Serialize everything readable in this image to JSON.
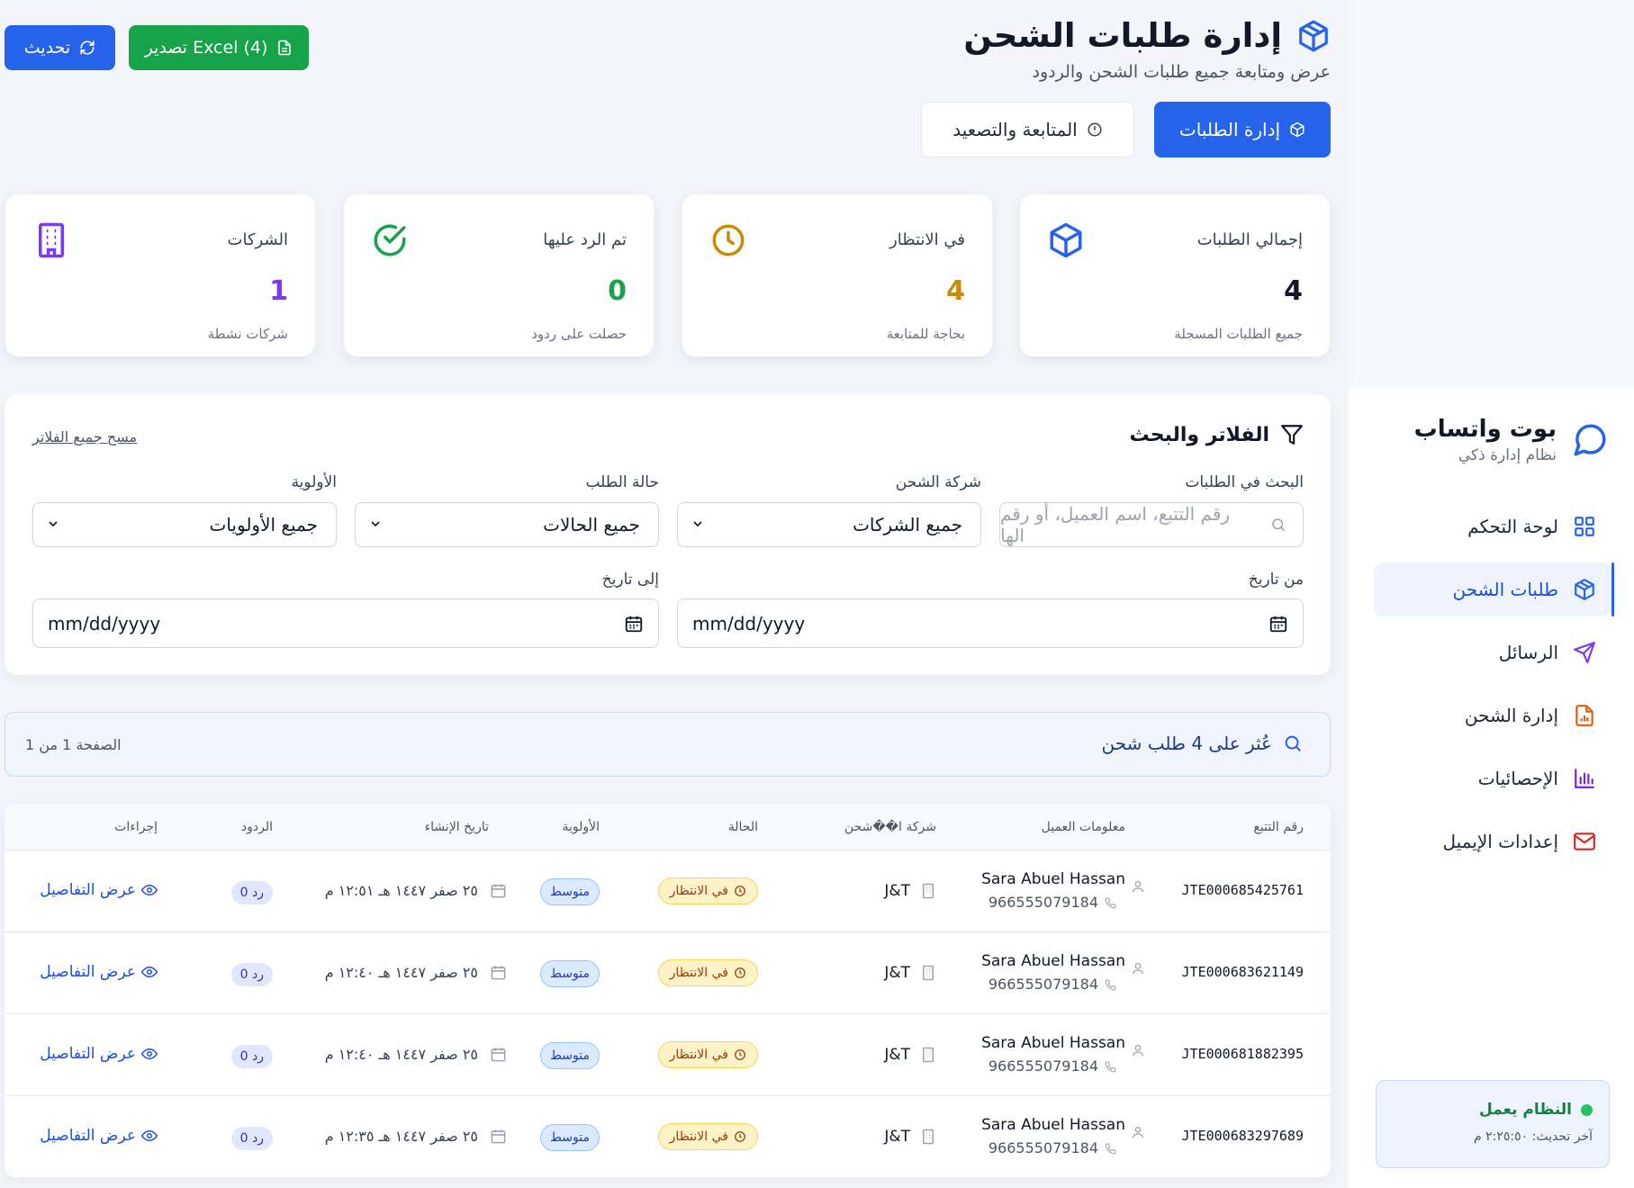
{
  "header": {
    "title": "إدارة طلبات الشحن",
    "subtitle": "عرض ومتابعة جميع طلبات الشحن والردود",
    "refresh_label": "تحديث",
    "export_label": "تصدير Excel (4)",
    "manage_label": "إدارة الطلبات",
    "follow_label": "المتابعة والتصعيد"
  },
  "stats": [
    {
      "label": "إجمالي الطلبات",
      "value": "4",
      "sub": "جميع الطلبات المسجلة",
      "color": "#111827"
    },
    {
      "label": "في الانتظار",
      "value": "4",
      "sub": "بحاجة للمتابعة",
      "color": "#ca8a04"
    },
    {
      "label": "تم الرد عليها",
      "value": "0",
      "sub": "حصلت على ردود",
      "color": "#16a34a"
    },
    {
      "label": "الشركات",
      "value": "1",
      "sub": "شركات نشطة",
      "color": "#7c3aed"
    }
  ],
  "filters": {
    "title": "الفلاتر والبحث",
    "clear_label": "مسح جميع الفلاتر",
    "search_label": "البحث في الطلبات",
    "search_placeholder": "رقم التتبع، اسم العميل، أو رقم الها",
    "company_label": "شركة الشحن",
    "company_value": "جميع الشركات",
    "status_label": "حالة الطلب",
    "status_value": "جميع الحالات",
    "priority_label": "الأولوية",
    "priority_value": "جميع الأولويات",
    "from_label": "من تاريخ",
    "to_label": "إلى تاريخ",
    "date_placeholder": "mm/dd/yyyy"
  },
  "results": {
    "text": "عُثر على 4 طلب شحن",
    "page": "الصفحة 1 من 1"
  },
  "table": {
    "headers": {
      "tracking": "رقم التتبع",
      "customer": "معلومات العميل",
      "company": "شركة ا��شحن",
      "status": "الحالة",
      "priority": "الأولوية",
      "created": "تاريخ الإنشاء",
      "replies": "الردود",
      "actions": "إجراءات"
    },
    "rows": [
      {
        "tracking": "JTE000685425761",
        "name": "Sara Abuel Hassan",
        "phone": "966555079184",
        "company": "J&T",
        "status": "في الانتظار",
        "priority": "متوسط",
        "created": "٢٥ صفر ١٤٤٧ هـ ١٢:٥١ م",
        "replies": "0 رد",
        "action": "عرض التفاصيل"
      },
      {
        "tracking": "JTE000683621149",
        "name": "Sara Abuel Hassan",
        "phone": "966555079184",
        "company": "J&T",
        "status": "في الانتظار",
        "priority": "متوسط",
        "created": "٢٥ صفر ١٤٤٧ هـ ١٢:٤٠ م",
        "replies": "0 رد",
        "action": "عرض التفاصيل"
      },
      {
        "tracking": "JTE000681882395",
        "name": "Sara Abuel Hassan",
        "phone": "966555079184",
        "company": "J&T",
        "status": "في الانتظار",
        "priority": "متوسط",
        "created": "٢٥ صفر ١٤٤٧ هـ ١٢:٤٠ م",
        "replies": "0 رد",
        "action": "عرض التفاصيل"
      },
      {
        "tracking": "JTE000683297689",
        "name": "Sara Abuel Hassan",
        "phone": "966555079184",
        "company": "J&T",
        "status": "في الانتظار",
        "priority": "متوسط",
        "created": "٢٥ صفر ١٤٤٧ هـ ١٢:٣٥ م",
        "replies": "0 رد",
        "action": "عرض التفاصيل"
      }
    ]
  },
  "sidebar": {
    "brand_title": "بوت واتساب",
    "brand_sub": "نظام إدارة ذكي",
    "items": [
      {
        "label": "لوحة التحكم",
        "icon": "grid-icon",
        "color": "#2563eb"
      },
      {
        "label": "طلبات الشحن",
        "icon": "package-icon",
        "color": "#2563eb"
      },
      {
        "label": "الرسائل",
        "icon": "send-icon",
        "color": "#7c3aed"
      },
      {
        "label": "إدارة الشحن",
        "icon": "file-chart-icon",
        "color": "#ea580c"
      },
      {
        "label": "الإحصائيات",
        "icon": "bar-chart-icon",
        "color": "#6d28d9"
      },
      {
        "label": "إعدادات الإيميل",
        "icon": "mail-icon",
        "color": "#dc2626"
      }
    ],
    "status_text": "النظام يعمل",
    "status_time": "آخر تحديث: ٢:٢٥:٥٠ م"
  },
  "colors": {
    "primary": "#2563eb",
    "success": "#16a34a",
    "warning": "#ca8a04",
    "purple": "#7c3aed"
  }
}
